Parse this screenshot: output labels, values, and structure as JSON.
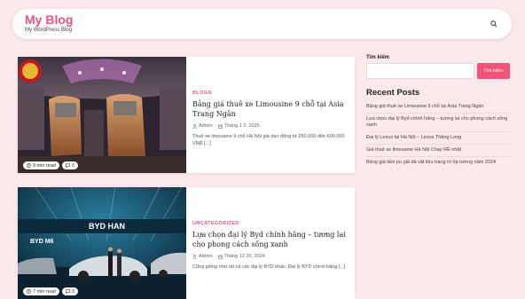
{
  "header": {
    "title": "My Blog",
    "tagline": "My WordPress Blog",
    "search_icon": "search-icon"
  },
  "posts": [
    {
      "category": "BLOGS",
      "title": "Bảng giá thuê xe Limousine 9 chỗ tại Asia Trang Ngân",
      "author": "Admin",
      "date": "Tháng 1 2, 2025",
      "excerpt": "Thuê xe limousine 9 chỗ Hà Nội giá dao động từ 250.000 đến 600.000 VNĐ [...]",
      "read_time": "9 min read",
      "comments": "0"
    },
    {
      "category": "UNCATEGORIZED",
      "title": "Lựa chọn đại lý Byd chính hãng – tương lai cho phong cách sống xanh",
      "author": "Admin",
      "date": "Tháng 12 20, 2024",
      "excerpt": "Cũng giống như tất cả các đại lý BYD khác, Đại lý BYD chính hãng [...]",
      "read_time": "7 min read",
      "comments": "0"
    }
  ],
  "thumb_labels": {
    "byd_han": "BYD HAN",
    "byd_m6": "BYD M6"
  },
  "sidebar": {
    "search_label": "Tìm kiếm",
    "search_placeholder": "",
    "search_button": "Tìm kiếm",
    "recent_heading": "Recent Posts",
    "recent": [
      "Bảng giá thuê xe Limousine 9 chỗ tại Asia Trang Ngân",
      "Lựa chọn đại lý Byd chính hãng – tương lai cho phong cách sống xanh",
      "Đại lý Lexus tại Hà Nội – Lexus Thăng Long",
      "Giá thuê xe limousine Hà Nội Chạy RẺ nhất",
      "Bảng giá tấm pu giả đá vật liệu trang trí ốp tường năm 2024"
    ]
  },
  "colors": {
    "accent": "#f0527a",
    "background": "#fbe9ec"
  }
}
